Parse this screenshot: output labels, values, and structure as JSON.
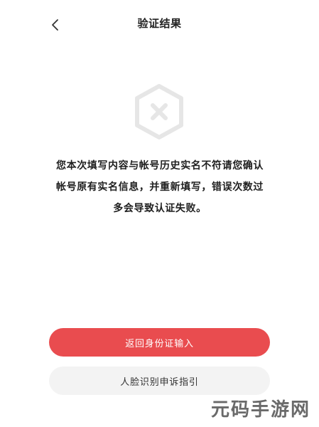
{
  "header": {
    "back_icon": "chevron-left-icon",
    "title": "验证结果"
  },
  "result": {
    "status_icon": "error-x-hexagon-icon",
    "icon_color": "#e6e6e6",
    "message_lines": [
      "您本次填写内容与帐号历史实名不符请您确认",
      "帐号原有实名信息，并重新填写，错误次数过",
      "多会导致认证失败。"
    ]
  },
  "actions": {
    "primary_label": "返回身份证输入",
    "secondary_label": "人脸识别申诉指引",
    "primary_color": "#e94c4f"
  },
  "watermark": {
    "text": "元码手游网"
  }
}
